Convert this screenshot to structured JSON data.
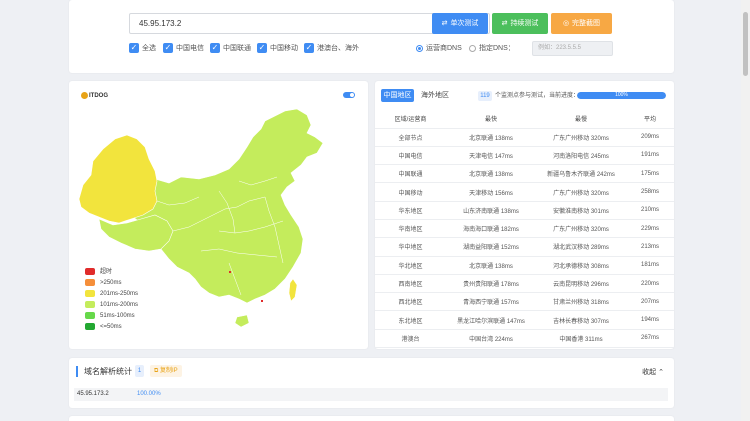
{
  "search": {
    "value": "45.95.173.2",
    "clear_icon": "clear-icon"
  },
  "buttons": {
    "single": "单次测试",
    "continuous": "持续测试",
    "screenshot": "完整截图",
    "colors": {
      "single": "#3f8cf3",
      "continuous": "#4cbf5c",
      "screenshot": "#f7a844"
    }
  },
  "checks": [
    "全选",
    "中国电信",
    "中国联通",
    "中国移动",
    "港澳台、海外"
  ],
  "dns": {
    "operator_label": "运营商DNS",
    "custom_label": "指定DNS：",
    "custom_placeholder": "例如：223.5.5.5"
  },
  "map": {
    "logo": "ITDOG",
    "legend": [
      {
        "label": "超时",
        "color": "#e02b2b"
      },
      {
        "label": ">250ms",
        "color": "#f58f3a"
      },
      {
        "label": "201ms-250ms",
        "color": "#f2e43d"
      },
      {
        "label": "101ms-200ms",
        "color": "#c4ec5c"
      },
      {
        "label": "51ms-100ms",
        "color": "#66d84a"
      },
      {
        "label": "<=50ms",
        "color": "#23a832"
      }
    ]
  },
  "table": {
    "tab_active": "中国地区",
    "tab_inactive": "海外地区",
    "count": "119",
    "count_text": "个监测点参与测试，当前进度：",
    "progress_percent": 100,
    "progress_label": "100%",
    "headers": [
      "区域/运营商",
      "最快",
      "最慢",
      "平均"
    ],
    "rows": [
      [
        "全部节点",
        "北京联通 138ms",
        "广东广州移动 320ms",
        "209ms"
      ],
      [
        "中国电信",
        "天津电信 147ms",
        "河南洛阳电信 245ms",
        "191ms"
      ],
      [
        "中国联通",
        "北京联通 138ms",
        "新疆乌鲁木齐联通 242ms",
        "175ms"
      ],
      [
        "中国移动",
        "天津移动 156ms",
        "广东广州移动 320ms",
        "258ms"
      ],
      [
        "华东地区",
        "山东济南联通 138ms",
        "安徽淮南移动 301ms",
        "210ms"
      ],
      [
        "华南地区",
        "海南海口联通 182ms",
        "广东广州移动 320ms",
        "229ms"
      ],
      [
        "华中地区",
        "湖南益阳联通 152ms",
        "湖北武汉移动 289ms",
        "213ms"
      ],
      [
        "华北地区",
        "北京联通 138ms",
        "河北承德移动 308ms",
        "181ms"
      ],
      [
        "西南地区",
        "贵州贵阳联通 178ms",
        "云南昆明移动 296ms",
        "220ms"
      ],
      [
        "西北地区",
        "青海西宁联通 157ms",
        "甘肃兰州移动 318ms",
        "207ms"
      ],
      [
        "东北地区",
        "黑龙江哈尔滨联通 147ms",
        "吉林长春移动 307ms",
        "194ms"
      ],
      [
        "港澳台",
        "中国台湾 224ms",
        "中国香港 311ms",
        "267ms"
      ]
    ]
  },
  "dns_stats": {
    "title": "域名解析统计",
    "count": "1",
    "copy_label": "复制IP",
    "collapse_label": "收起",
    "row": {
      "ip": "45.95.173.2",
      "percent": "100.00%"
    }
  }
}
